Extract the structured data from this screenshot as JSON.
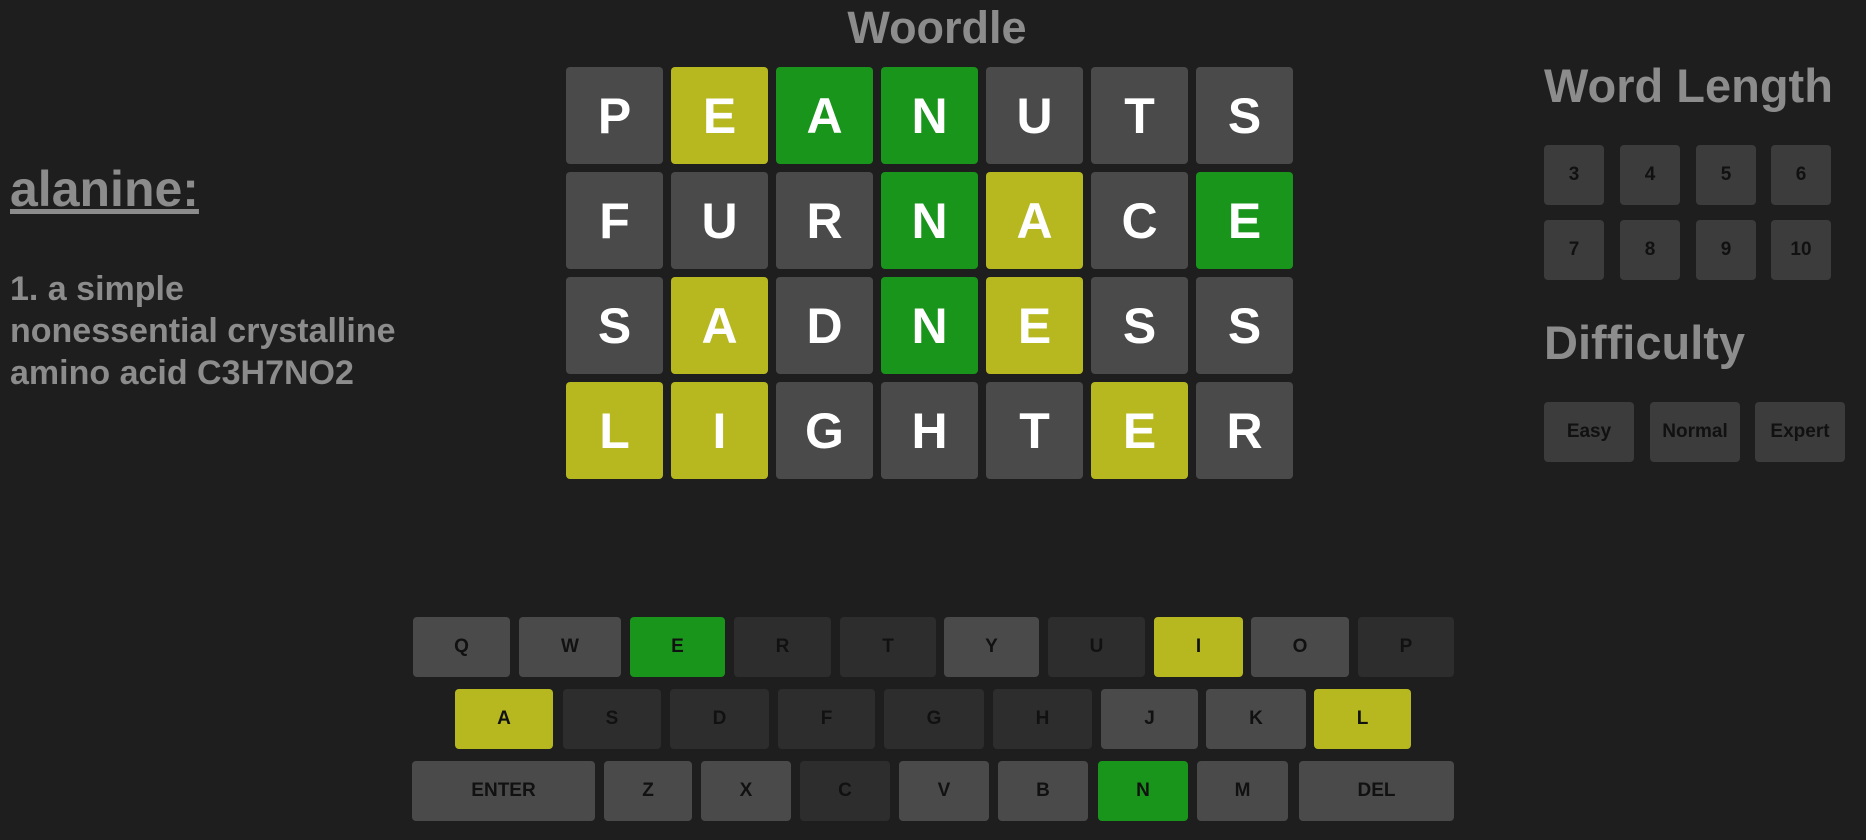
{
  "app": {
    "title": "Woordle"
  },
  "definition": {
    "word": "alanine:",
    "text": "1. a simple nonessential crystalline amino acid C3H7NO2"
  },
  "board": {
    "rows": [
      [
        {
          "letter": "P",
          "state": "absent"
        },
        {
          "letter": "E",
          "state": "present"
        },
        {
          "letter": "A",
          "state": "correct"
        },
        {
          "letter": "N",
          "state": "correct"
        },
        {
          "letter": "U",
          "state": "absent"
        },
        {
          "letter": "T",
          "state": "absent"
        },
        {
          "letter": "S",
          "state": "absent"
        }
      ],
      [
        {
          "letter": "F",
          "state": "absent"
        },
        {
          "letter": "U",
          "state": "absent"
        },
        {
          "letter": "R",
          "state": "absent"
        },
        {
          "letter": "N",
          "state": "correct"
        },
        {
          "letter": "A",
          "state": "present"
        },
        {
          "letter": "C",
          "state": "absent"
        },
        {
          "letter": "E",
          "state": "correct"
        }
      ],
      [
        {
          "letter": "S",
          "state": "absent"
        },
        {
          "letter": "A",
          "state": "present"
        },
        {
          "letter": "D",
          "state": "absent"
        },
        {
          "letter": "N",
          "state": "correct"
        },
        {
          "letter": "E",
          "state": "present"
        },
        {
          "letter": "S",
          "state": "absent"
        },
        {
          "letter": "S",
          "state": "absent"
        }
      ],
      [
        {
          "letter": "L",
          "state": "present"
        },
        {
          "letter": "I",
          "state": "present"
        },
        {
          "letter": "G",
          "state": "absent"
        },
        {
          "letter": "H",
          "state": "absent"
        },
        {
          "letter": "T",
          "state": "absent"
        },
        {
          "letter": "E",
          "state": "present"
        },
        {
          "letter": "R",
          "state": "absent"
        }
      ]
    ]
  },
  "keyboard": {
    "rows": [
      [
        {
          "label": "Q",
          "state": "unused"
        },
        {
          "label": "W",
          "state": "unused"
        },
        {
          "label": "E",
          "state": "correct"
        },
        {
          "label": "R",
          "state": "absent"
        },
        {
          "label": "T",
          "state": "absent"
        },
        {
          "label": "Y",
          "state": "unused"
        },
        {
          "label": "U",
          "state": "absent"
        },
        {
          "label": "I",
          "state": "present"
        },
        {
          "label": "O",
          "state": "unused"
        },
        {
          "label": "P",
          "state": "absent"
        }
      ],
      [
        {
          "label": "A",
          "state": "present"
        },
        {
          "label": "S",
          "state": "absent"
        },
        {
          "label": "D",
          "state": "absent"
        },
        {
          "label": "F",
          "state": "absent"
        },
        {
          "label": "G",
          "state": "absent"
        },
        {
          "label": "H",
          "state": "absent"
        },
        {
          "label": "J",
          "state": "unused"
        },
        {
          "label": "K",
          "state": "unused"
        },
        {
          "label": "L",
          "state": "present"
        }
      ],
      [
        {
          "label": "ENTER",
          "state": "unused"
        },
        {
          "label": "Z",
          "state": "unused"
        },
        {
          "label": "X",
          "state": "unused"
        },
        {
          "label": "C",
          "state": "absent"
        },
        {
          "label": "V",
          "state": "unused"
        },
        {
          "label": "B",
          "state": "unused"
        },
        {
          "label": "N",
          "state": "correct"
        },
        {
          "label": "M",
          "state": "unused"
        },
        {
          "label": "DEL",
          "state": "unused"
        }
      ]
    ]
  },
  "word_length": {
    "heading": "Word Length",
    "options": [
      "3",
      "4",
      "5",
      "6",
      "7",
      "8",
      "9",
      "10"
    ]
  },
  "difficulty": {
    "heading": "Difficulty",
    "options": [
      "Easy",
      "Normal",
      "Expert"
    ]
  },
  "colors": {
    "background": "#1e1e1e",
    "correct": "#19951b",
    "present": "#b7b820",
    "absent_tile": "#4a4a4a",
    "absent_key": "#2d2d2d",
    "unused_key": "#4a4a4a",
    "text_muted": "#8c8c8c"
  }
}
